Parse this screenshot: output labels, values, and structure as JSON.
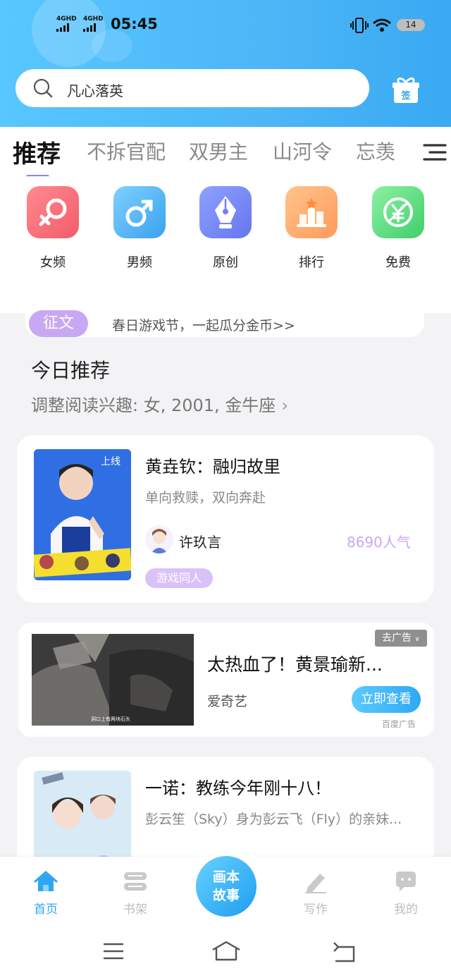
{
  "status_bar": {
    "signal_1": "4GHD",
    "signal_2": "4GHD",
    "time": "05:45",
    "battery": "14"
  },
  "search": {
    "placeholder": "凡心落英"
  },
  "gift_label": "签",
  "tabs": [
    {
      "label": "推荐",
      "active": true
    },
    {
      "label": "不拆官配"
    },
    {
      "label": "双男主"
    },
    {
      "label": "山河令"
    },
    {
      "label": "忘羡"
    }
  ],
  "categories": [
    {
      "label": "女频",
      "icon": "female-icon"
    },
    {
      "label": "男频",
      "icon": "male-icon"
    },
    {
      "label": "原创",
      "icon": "pen-nib-icon"
    },
    {
      "label": "排行",
      "icon": "ranking-icon"
    },
    {
      "label": "免费",
      "icon": "free-yen-icon"
    }
  ],
  "banner": {
    "badge": "征文",
    "text": "春日游戏节，一起瓜分金币>>"
  },
  "today": {
    "title": "今日推荐",
    "preference": "调整阅读兴趣: 女, 2001, 金牛座"
  },
  "books": [
    {
      "title": "黄垚钦：融归故里",
      "subtitle": "单向救赎，双向奔赴",
      "author": "许玖言",
      "popularity": "8690人气",
      "tag": "游戏同人"
    },
    {
      "title": "一诺：教练今年刚十八！",
      "subtitle": "彭云笙（Sky）身为彭云飞（Fly）的亲妹..."
    }
  ],
  "ad": {
    "close_label": "去广告",
    "title": "太热血了！黄景瑜新...",
    "source": "爱奇艺",
    "button": "立即查看",
    "label": "百度广告",
    "image_caption": "洞口上有两块石头"
  },
  "bottom_nav": {
    "items": [
      {
        "label": "首页",
        "active": true
      },
      {
        "label": "书架"
      },
      {
        "label": "写作"
      },
      {
        "label": "我的"
      }
    ],
    "center_line1": "画本",
    "center_line2": "故事"
  },
  "colors": {
    "accent_blue": "#2ea7f2",
    "accent_purple": "#9d7cf0",
    "tag_purple": "#d9c2f7"
  }
}
